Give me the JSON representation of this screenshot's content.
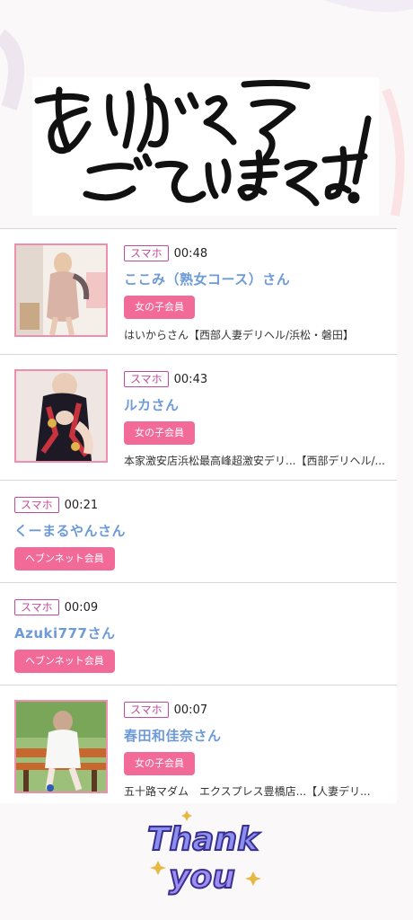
{
  "hero": {
    "title": "ありがとうございます!"
  },
  "entries": [
    {
      "device": "スマホ",
      "time": "00:48",
      "name": "ここみ（熟女コース）さん",
      "membership": "女の子会員",
      "shop": "はいからさん【西部人妻デリヘル/浜松・磐田】"
    },
    {
      "device": "スマホ",
      "time": "00:43",
      "name": "ルカさん",
      "membership": "女の子会員",
      "shop": "本家激安店浜松最高峰超激安デリ...【西部デリヘル/..."
    },
    {
      "device": "スマホ",
      "time": "00:21",
      "name": "くーまるやんさん",
      "membership": "ヘブンネット会員"
    },
    {
      "device": "スマホ",
      "time": "00:09",
      "name": "Azuki777さん",
      "membership": "ヘブンネット会員"
    },
    {
      "device": "スマホ",
      "time": "00:07",
      "name": "春田和佳奈さん",
      "membership": "女の子会員",
      "shop": "五十路マダム　エクスプレス豊橋店...【人妻デリ..."
    }
  ],
  "footer": {
    "thanks_text": "Thank you"
  },
  "colors": {
    "accent_pink": "#f26a98",
    "name_blue": "#6e9ad8",
    "tag_magenta": "#c64a9a"
  }
}
